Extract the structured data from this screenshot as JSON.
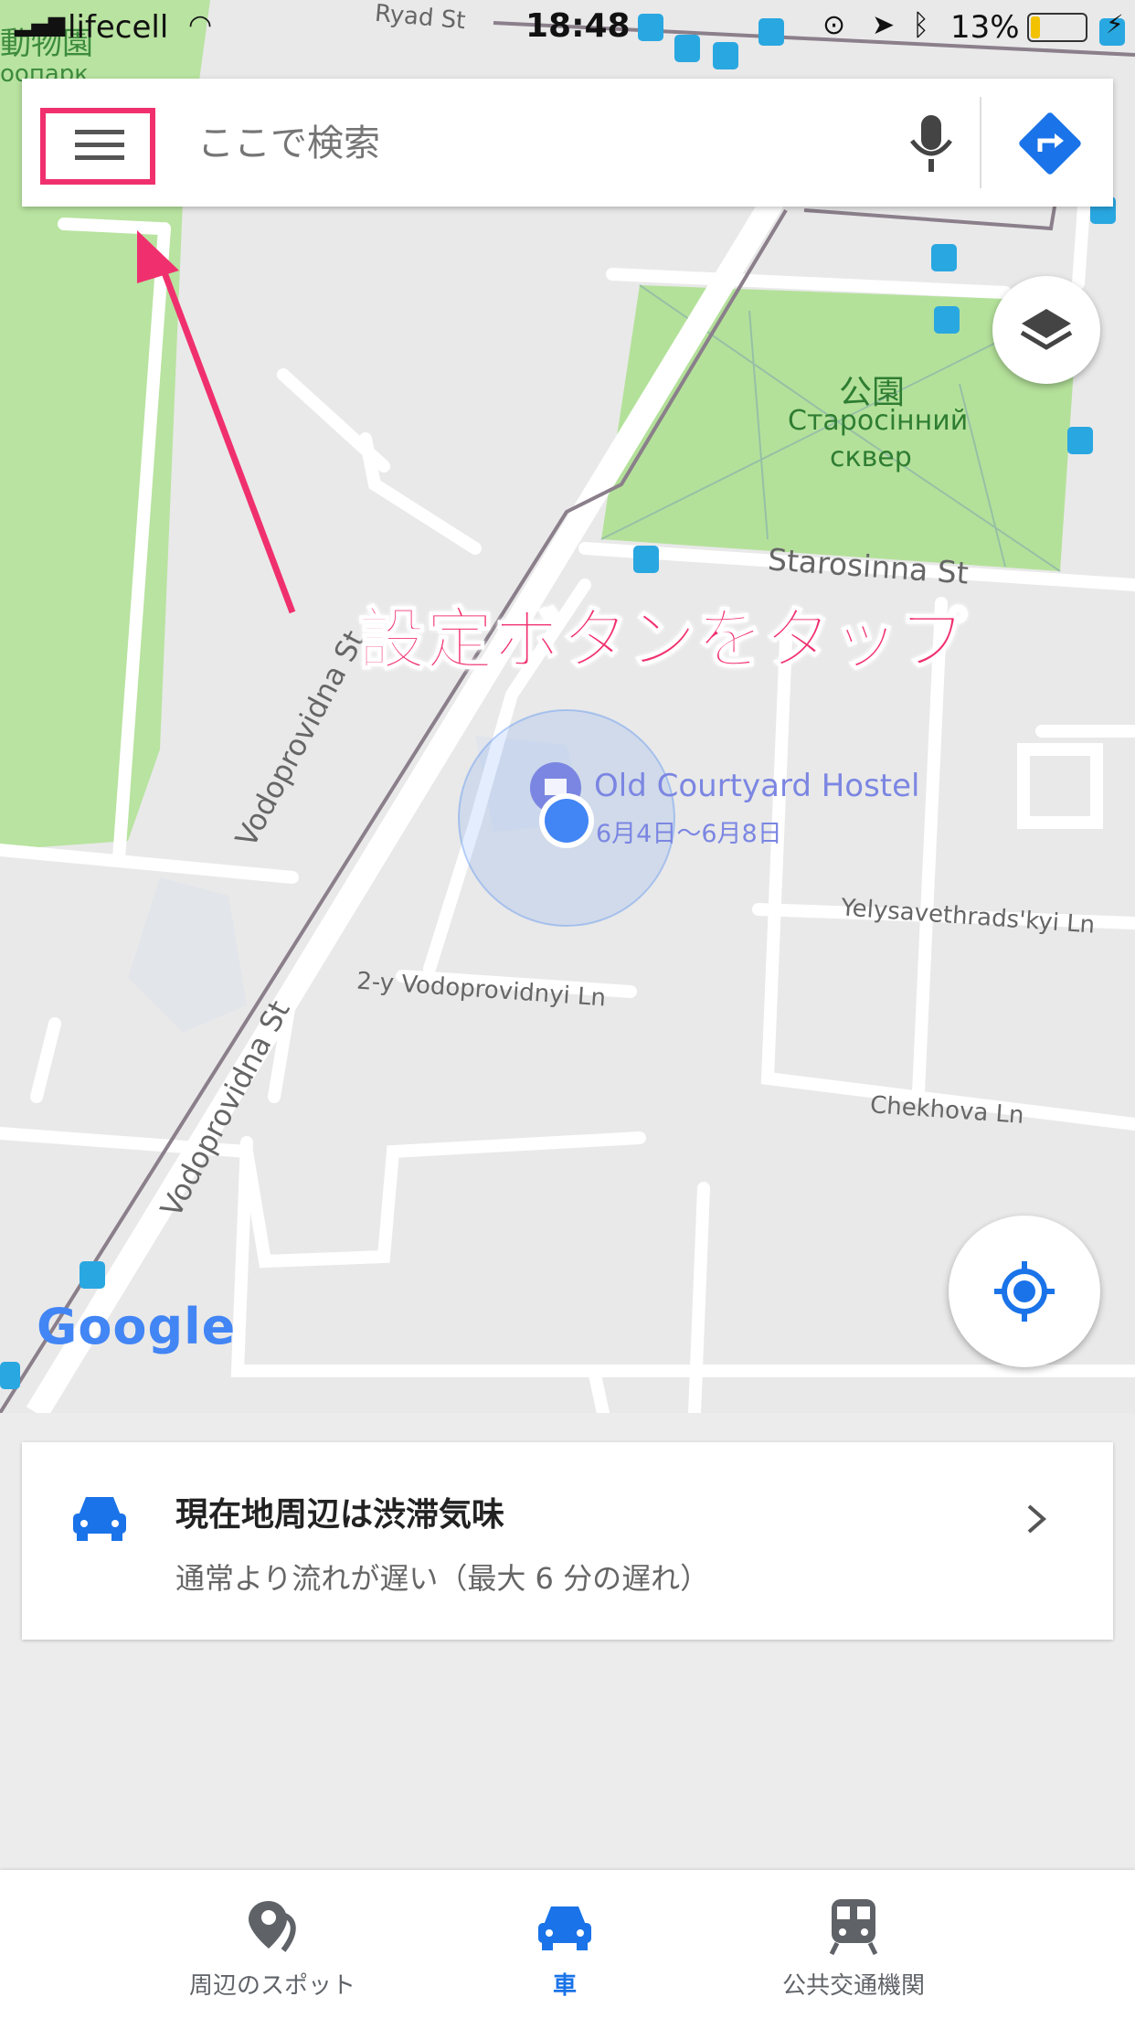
{
  "status_bar": {
    "carrier": "lifecell",
    "time": "18:48",
    "battery": "13%"
  },
  "search": {
    "placeholder": "ここで検索"
  },
  "map": {
    "park_title": "公園",
    "park_name_line1": "Старосінний",
    "park_name_line2": "сквер",
    "zoo_label_line1": "動物園",
    "zoo_label_line2": "оопарк",
    "streets": {
      "starosinna": "Starosinna St",
      "vodoprovidna_upper": "Vodoprovidna St",
      "vodoprovidna_lower": "Vodoprovidna St",
      "vodoprovidnyi_ln": "2-y Vodoprovidnyi Ln",
      "yelysavethrads": "Yelysavethrads'kyi Ln",
      "chekhova": "Chekhova Ln",
      "ryad": "Ryad St"
    },
    "place_name": "Old Courtyard Hostel",
    "place_dates": "6月4日～6月8日",
    "google_logo": "Google"
  },
  "annotation": {
    "text": "設定ボタンをタップ",
    "color": "#f0306e"
  },
  "traffic_card": {
    "title": "現在地周辺は渋滞気味",
    "subtitle": "通常より流れが遅い（最大 6 分の遅れ）"
  },
  "bottom_nav": {
    "items": [
      {
        "label": "周辺のスポット",
        "icon": "place-pin-icon"
      },
      {
        "label": "車",
        "icon": "car-icon",
        "active": true
      },
      {
        "label": "公共交通機関",
        "icon": "train-icon"
      }
    ]
  },
  "colors": {
    "accent_blue": "#4285f4",
    "park_green": "#b4e19a",
    "annotation_pink": "#f0306e"
  }
}
